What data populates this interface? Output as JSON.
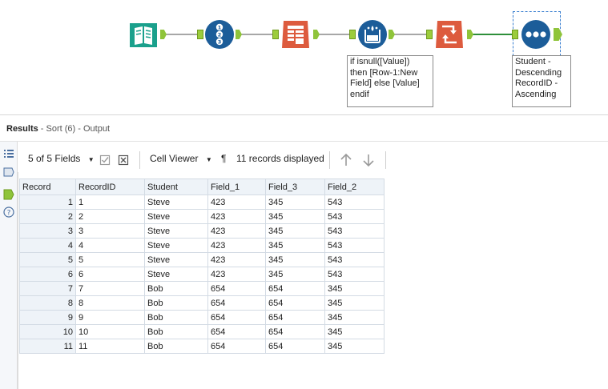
{
  "workflow": {
    "tools": [
      {
        "name": "input-data-tool",
        "icon": "book-icon",
        "color": "#1aa08c"
      },
      {
        "name": "record-id-tool",
        "icon": "numbered-list-icon",
        "color": "#1c5d99"
      },
      {
        "name": "crosstab-tool",
        "icon": "table-transform-icon",
        "color": "#dd5b3e"
      },
      {
        "name": "multi-row-formula-tool",
        "icon": "beaker-icon",
        "color": "#1c5d99"
      },
      {
        "name": "sort-transpose-tool",
        "icon": "arrows-icon",
        "color": "#dd5b3e"
      },
      {
        "name": "sort-tool",
        "icon": "dots-icon",
        "color": "#1c5d99"
      }
    ],
    "annotations": {
      "formula": "if isnull([Value])\nthen [Row-1:New\nField] else [Value]\nendif",
      "sort": "Student -\nDescending\nRecordID -\nAscending"
    },
    "anchor_color": "#8fc43a"
  },
  "results": {
    "title_bold": "Results",
    "title_rest": " - Sort (6) - Output"
  },
  "toolbar": {
    "fields_selector": "5 of 5 Fields",
    "cell_viewer": "Cell Viewer",
    "pilcrow": "¶",
    "records_displayed": "11 records displayed"
  },
  "grid": {
    "columns": [
      "Record",
      "RecordID",
      "Student",
      "Field_1",
      "Field_3",
      "Field_2"
    ],
    "rows": [
      [
        "1",
        "1",
        "Steve",
        "423",
        "345",
        "543"
      ],
      [
        "2",
        "2",
        "Steve",
        "423",
        "345",
        "543"
      ],
      [
        "3",
        "3",
        "Steve",
        "423",
        "345",
        "543"
      ],
      [
        "4",
        "4",
        "Steve",
        "423",
        "345",
        "543"
      ],
      [
        "5",
        "5",
        "Steve",
        "423",
        "345",
        "543"
      ],
      [
        "6",
        "6",
        "Steve",
        "423",
        "345",
        "543"
      ],
      [
        "7",
        "7",
        "Bob",
        "654",
        "654",
        "345"
      ],
      [
        "8",
        "8",
        "Bob",
        "654",
        "654",
        "345"
      ],
      [
        "9",
        "9",
        "Bob",
        "654",
        "654",
        "345"
      ],
      [
        "10",
        "10",
        "Bob",
        "654",
        "654",
        "345"
      ],
      [
        "11",
        "11",
        "Bob",
        "654",
        "654",
        "345"
      ]
    ]
  }
}
